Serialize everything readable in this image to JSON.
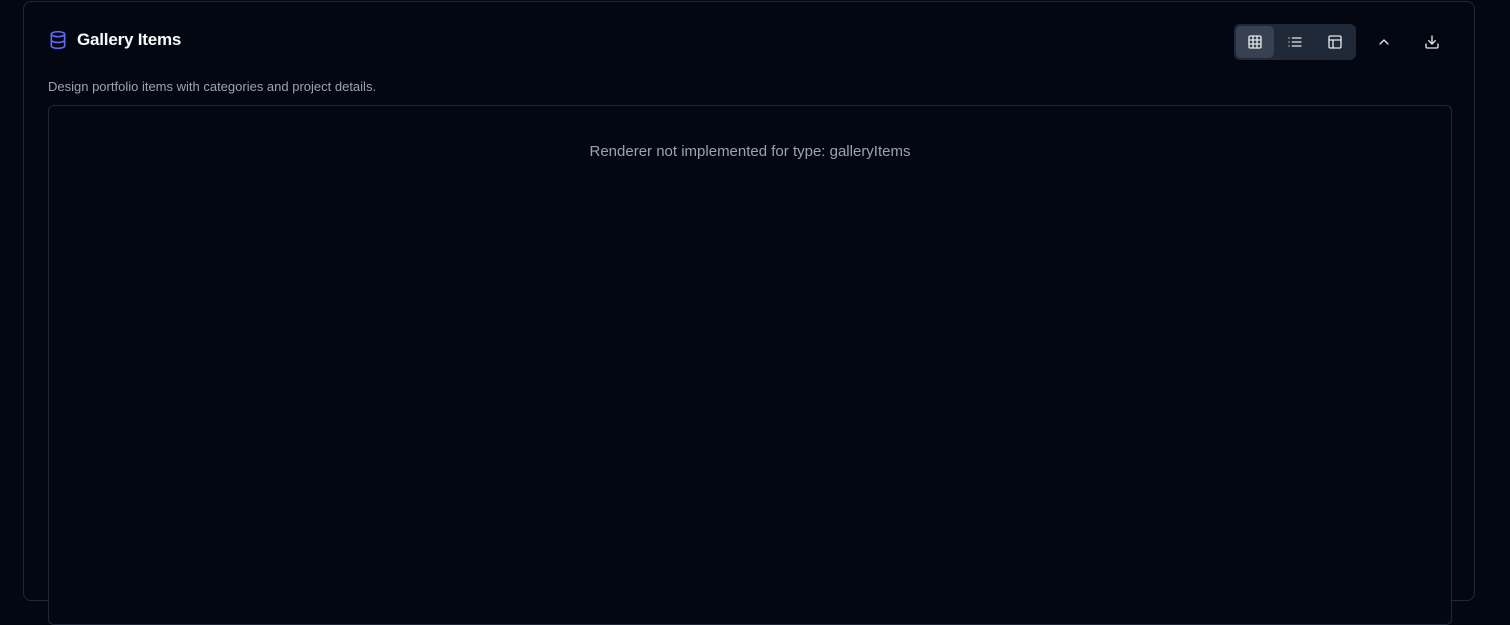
{
  "panel": {
    "title": "Gallery Items",
    "title_icon": "database-icon",
    "description": "Design portfolio items with categories and project details."
  },
  "toolbar": {
    "view_modes": [
      {
        "name": "grid-view",
        "icon": "grid-icon",
        "active": true
      },
      {
        "name": "list-view",
        "icon": "list-icon",
        "active": false
      },
      {
        "name": "table-view",
        "icon": "table-icon",
        "active": false
      }
    ],
    "actions": [
      {
        "name": "collapse",
        "icon": "chevron-up-icon"
      },
      {
        "name": "download",
        "icon": "download-icon"
      }
    ]
  },
  "content": {
    "message": "Renderer not implemented for type: galleryItems"
  },
  "colors": {
    "background": "#030712",
    "border": "#1f2937",
    "accent_icon": "#6366f1",
    "title_text": "#f9fafb",
    "muted_text": "#9ca3af",
    "active_toggle": "#374151"
  }
}
